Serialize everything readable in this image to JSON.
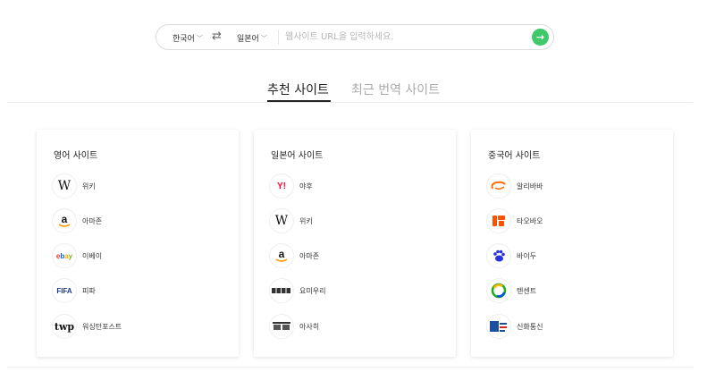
{
  "search": {
    "source_lang": "한국어",
    "target_lang": "일본어",
    "placeholder": "웹사이트 URL을 입력하세요.",
    "value": ""
  },
  "tabs": [
    {
      "label": "추천 사이트",
      "active": true
    },
    {
      "label": "최근 번역 사이트",
      "active": false
    }
  ],
  "cards": [
    {
      "title": "영어 사이트",
      "sites": [
        {
          "name": "위키",
          "icon": "wikipedia-icon"
        },
        {
          "name": "아마존",
          "icon": "amazon-icon"
        },
        {
          "name": "이베이",
          "icon": "ebay-icon"
        },
        {
          "name": "피파",
          "icon": "fifa-icon"
        },
        {
          "name": "워싱턴포스트",
          "icon": "washington-post-icon"
        }
      ]
    },
    {
      "title": "일본어 사이트",
      "sites": [
        {
          "name": "야후",
          "icon": "yahoo-icon"
        },
        {
          "name": "위키",
          "icon": "wikipedia-icon"
        },
        {
          "name": "아마존",
          "icon": "amazon-icon"
        },
        {
          "name": "요미우리",
          "icon": "yomiuri-icon"
        },
        {
          "name": "아사히",
          "icon": "asahi-icon"
        }
      ]
    },
    {
      "title": "중국어 사이트",
      "sites": [
        {
          "name": "알리바바",
          "icon": "alibaba-icon"
        },
        {
          "name": "타오바오",
          "icon": "taobao-icon"
        },
        {
          "name": "바이두",
          "icon": "baidu-icon"
        },
        {
          "name": "텐센트",
          "icon": "tencent-icon"
        },
        {
          "name": "신화통신",
          "icon": "xinhua-icon"
        }
      ]
    }
  ],
  "colors": {
    "accent": "#3fc96a",
    "text": "#222222",
    "muted": "#aaaaaa"
  }
}
